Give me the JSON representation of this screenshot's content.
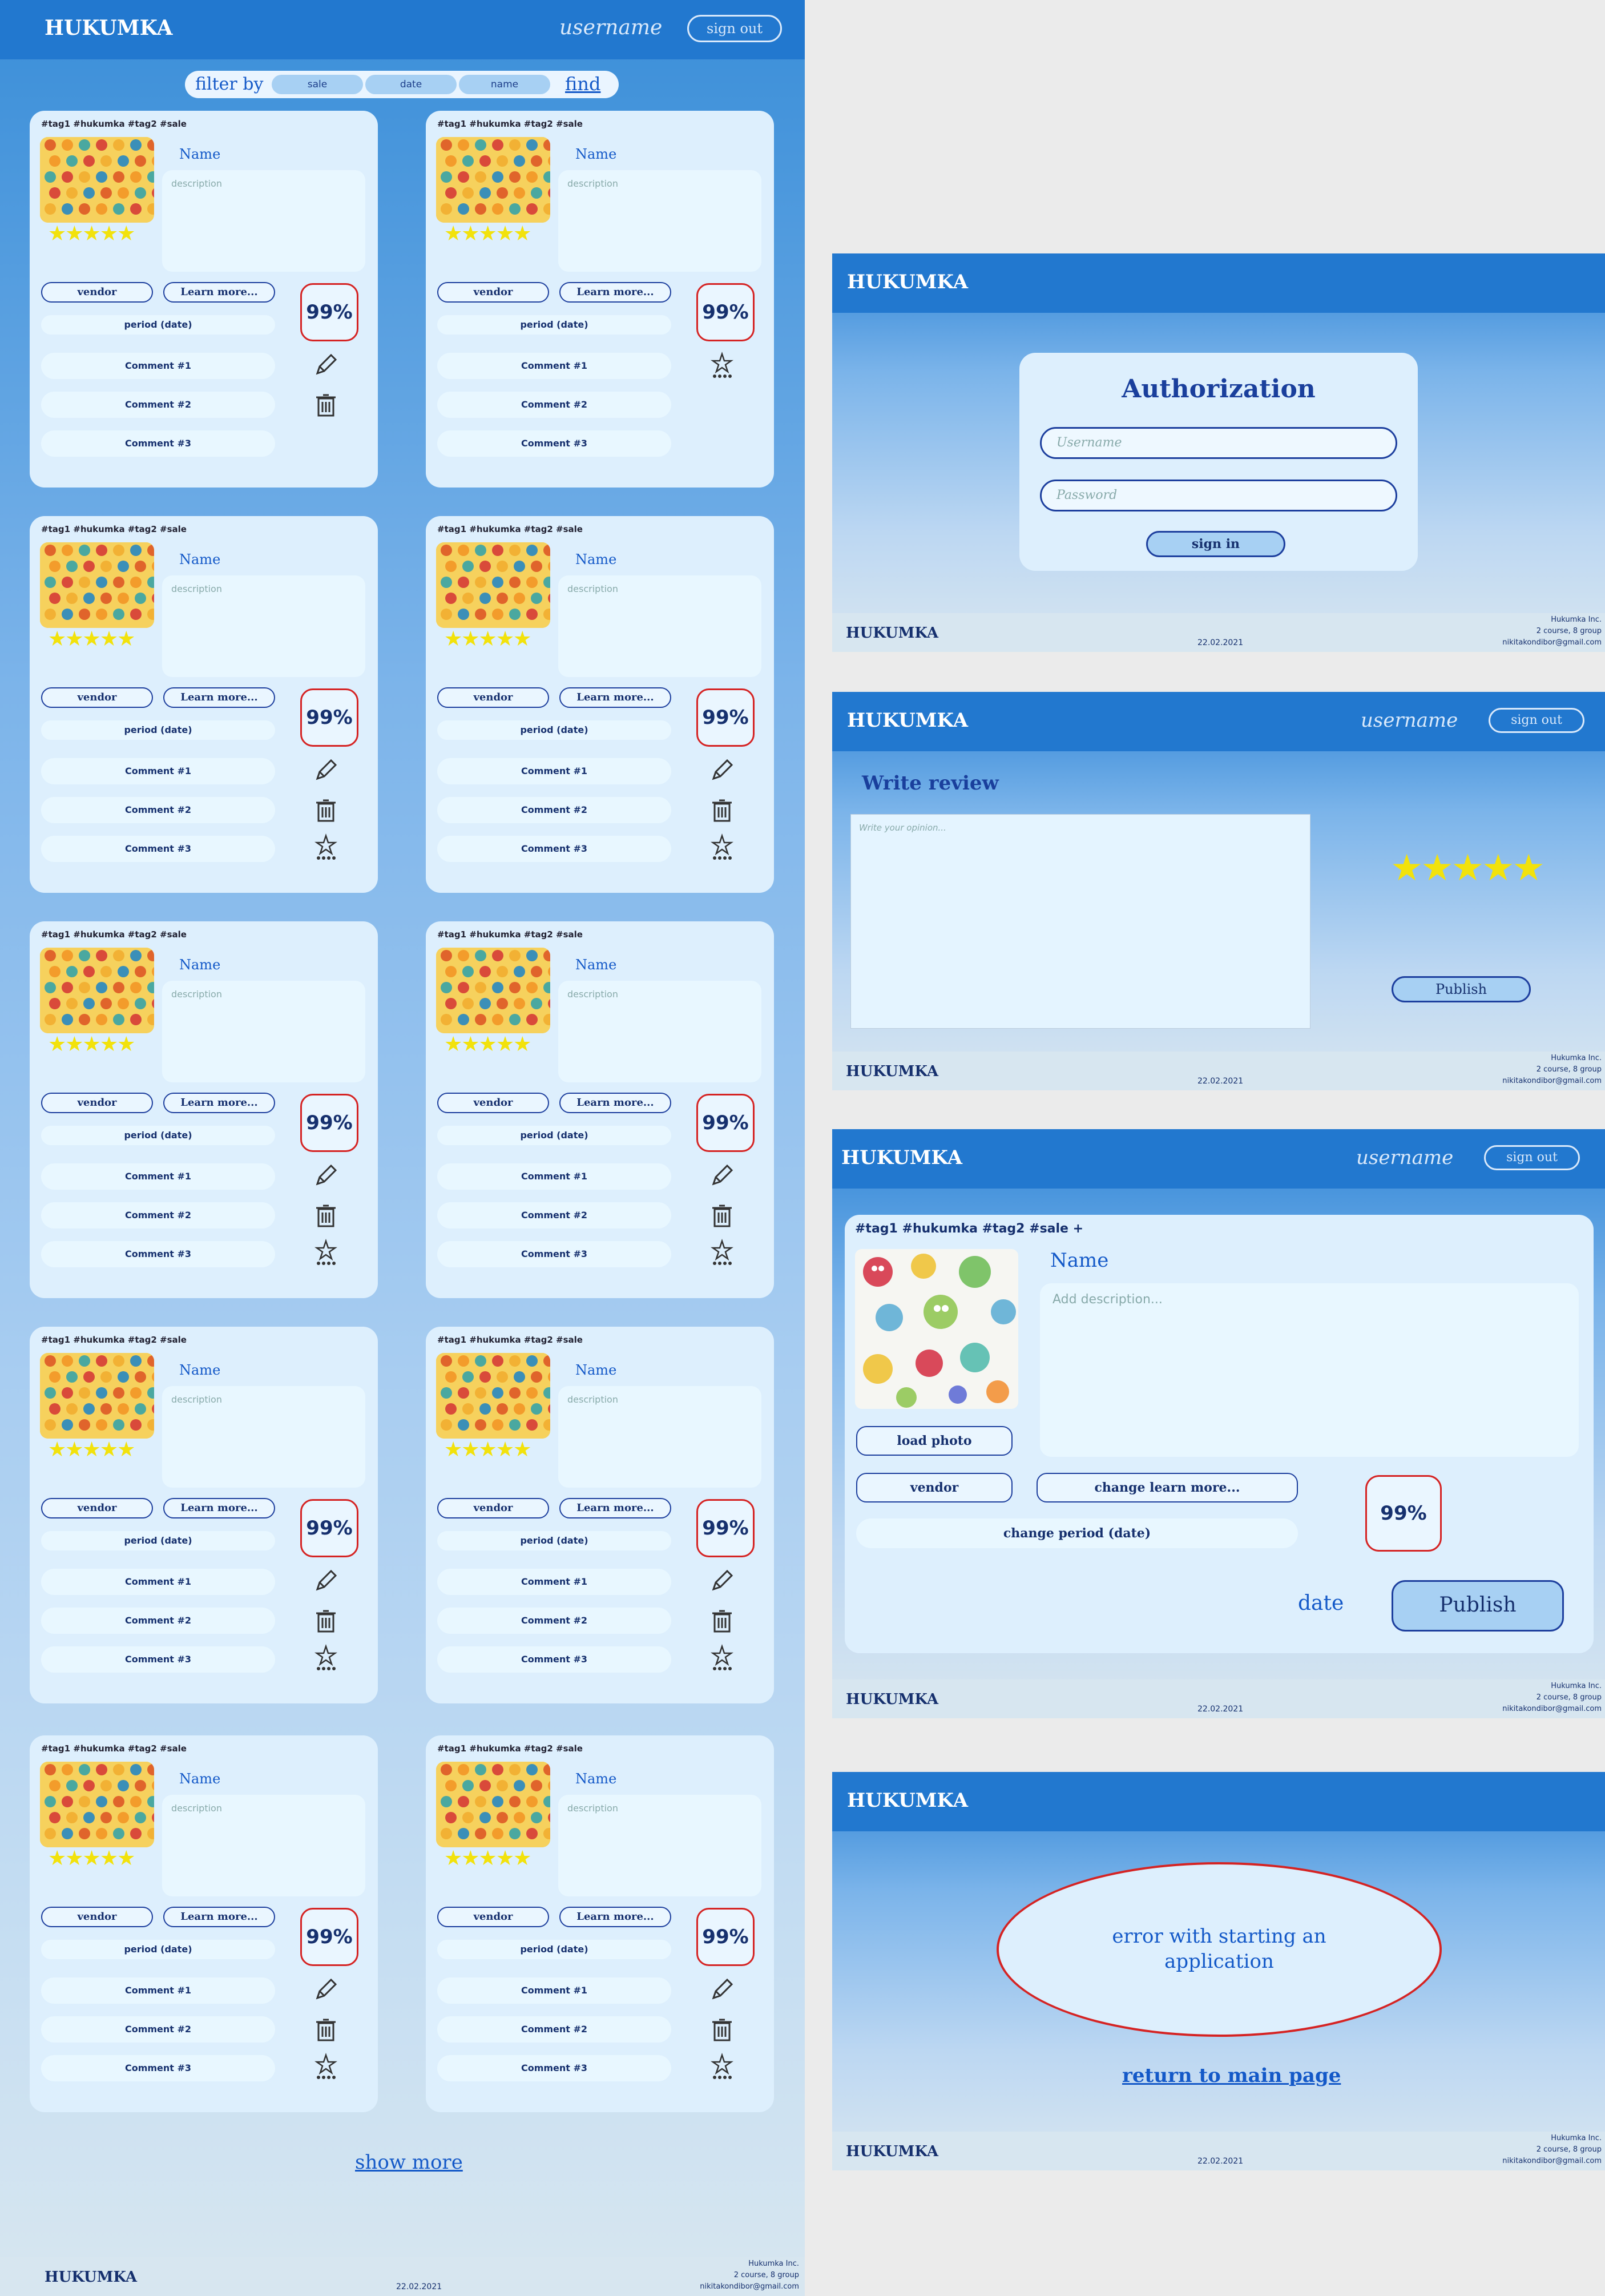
{
  "main": {
    "brand": "HUKUMKA",
    "username": "username",
    "sign_out": "sign out",
    "filter": {
      "label": "filter by",
      "options": [
        "sale",
        "date",
        "name"
      ],
      "find": "find"
    },
    "card": {
      "tags": "#tag1 #hukumka #tag2 #sale",
      "name": "Name",
      "description_placeholder": "description",
      "vendor": "vendor",
      "learn_more": "Learn more...",
      "period": "period (date)",
      "percent": "99%",
      "comments": [
        "Comment #1",
        "Comment #2",
        "Comment #3"
      ],
      "rating": 5
    },
    "show_more": "show more"
  },
  "footer": {
    "brand": "HUKUMKA",
    "date": "22.02.2021",
    "company": "Hukumka Inc.",
    "course": "2 course, 8 group",
    "email": "nikitakondibor@gmail.com"
  },
  "auth_screen": {
    "brand": "HUKUMKA",
    "title": "Authorization",
    "username_placeholder": "Username",
    "password_placeholder": "Password",
    "sign_in": "sign in"
  },
  "review_screen": {
    "brand": "HUKUMKA",
    "username": "username",
    "sign_out": "sign out",
    "title": "Write review",
    "placeholder": "Write your opinion...",
    "rating": 5,
    "publish": "Publish"
  },
  "create_screen": {
    "brand": "HUKUMKA",
    "username": "username",
    "sign_out": "sign out",
    "tags": "#tag1 #hukumka #tag2 #sale +",
    "name": "Name",
    "description_placeholder": "Add description...",
    "load_photo": "load photo",
    "vendor": "vendor",
    "change_learn_more": "change learn more...",
    "change_period": "change period (date)",
    "percent": "99%",
    "date": "date",
    "publish": "Publish"
  },
  "error_screen": {
    "brand": "HUKUMKA",
    "message": "error with starting an application",
    "return_link": "return to main page"
  },
  "colors": {
    "header": "#2278cf",
    "card": "#ddeffd",
    "accent": "#1459c8",
    "percent_border": "#d52323",
    "stars": "#f2e20c"
  }
}
